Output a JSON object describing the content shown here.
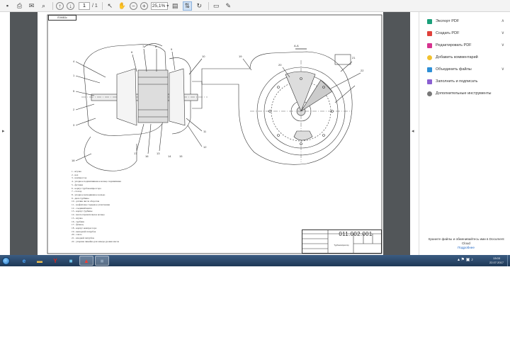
{
  "toolbar": {
    "page_current": "1",
    "page_total": "/ 1",
    "zoom": "25,1%"
  },
  "drawing": {
    "stamp_top": "Ё0МВ3с",
    "section_label": "A-A",
    "callouts": [
      "1",
      "2",
      "3",
      "4",
      "5",
      "6",
      "7",
      "8",
      "9",
      "10",
      "11",
      "12",
      "13",
      "14",
      "15",
      "16",
      "17",
      "18",
      "19",
      "20",
      "21",
      "22"
    ],
    "legend": [
      "1 - втулка",
      "2 - вал",
      "3 - компрессор",
      "4 - упорное подшипниковое кольцо подшипника",
      "5 - футовка",
      "6 - корпус турбокомпрессора",
      "7 - стопор",
      "8 - упорное неподвижное кольцо",
      "9 - диск турбины",
      "10 - датчик числа оборотов",
      "11 - графитовое торцевое уплотнение",
      "12 - соединяй винта",
      "13 - корпус турбины",
      "14 - маслоотражательное кольцо",
      "15 - втулка",
      "16 - турбина",
      "17 - фланец",
      "18 - корпус компрессора",
      "19 - выходной патрубок",
      "20 - сопло",
      "21 - входной патрубок",
      "22 - упорная линейка для замера уровня масла"
    ],
    "title_block": {
      "code": "011.002.001",
      "name": "Турбокомпрессор"
    }
  },
  "right_panel": {
    "tools": [
      {
        "label": "Экспорт PDF",
        "icon": "export-pdf-icon",
        "color": "#1aa07a",
        "chevron": "∧"
      },
      {
        "label": "Создать PDF",
        "icon": "create-pdf-icon",
        "color": "#e0413b",
        "chevron": "∨"
      },
      {
        "label": "Редактировать PDF",
        "icon": "edit-pdf-icon",
        "color": "#d6338f",
        "chevron": "∨"
      },
      {
        "label": "Добавить комментарий",
        "icon": "comment-icon",
        "color": "#f2c12e",
        "chevron": ""
      },
      {
        "label": "Объединить файлы",
        "icon": "combine-files-icon",
        "color": "#2d8fd6",
        "chevron": "∨"
      },
      {
        "label": "Заполнить и подписать",
        "icon": "fill-sign-icon",
        "color": "#8a5fd1",
        "chevron": ""
      },
      {
        "label": "Дополнительные инструменты",
        "icon": "more-tools-icon",
        "color": "#777777",
        "chevron": ""
      }
    ],
    "promo_text": "Храните файлы и обменивайтесь ими в Document Cloud",
    "promo_link": "Подробнее"
  },
  "taskbar": {
    "apps": [
      {
        "name": "taskbar-ie",
        "glyph": "e",
        "color": "#4aa8ff"
      },
      {
        "name": "taskbar-explorer",
        "glyph": "▬",
        "color": "#f2c14e"
      },
      {
        "name": "taskbar-yandex",
        "glyph": "Y",
        "color": "#e0241b"
      },
      {
        "name": "taskbar-app",
        "glyph": "■",
        "color": "#6fc3e8"
      },
      {
        "name": "taskbar-adobe",
        "glyph": "▲",
        "color": "#ff3b2f"
      },
      {
        "name": "taskbar-app2",
        "glyph": "■",
        "color": "#8da2b8"
      }
    ],
    "clock_time": "13:03",
    "clock_date": "22.07.2017",
    "tray_icons": "▴ ⚑ ▣ ♪"
  },
  "colors": {
    "doc_background": "#525659",
    "toolbar": "#f3f3f3",
    "accent_link": "#2168c7"
  }
}
